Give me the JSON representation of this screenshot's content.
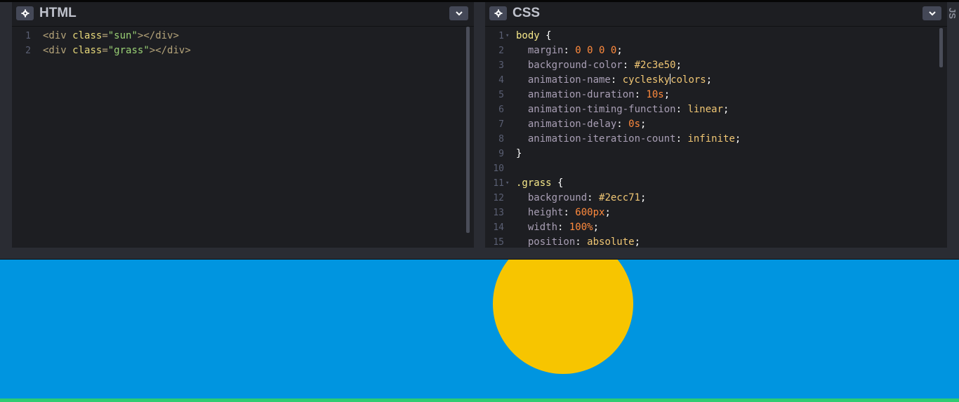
{
  "html_panel": {
    "title": "HTML",
    "lines": [
      {
        "n": "1",
        "parts": [
          [
            "tag",
            "<div "
          ],
          [
            "attr",
            "class"
          ],
          [
            "tag",
            "="
          ],
          [
            "str",
            "\"sun\""
          ],
          [
            "tag",
            "></div>"
          ]
        ]
      },
      {
        "n": "2",
        "parts": [
          [
            "tag",
            "<div "
          ],
          [
            "attr",
            "class"
          ],
          [
            "tag",
            "="
          ],
          [
            "str",
            "\"grass\""
          ],
          [
            "tag",
            "></div>"
          ]
        ]
      }
    ]
  },
  "css_panel": {
    "title": "CSS",
    "lines": [
      {
        "n": "1",
        "fold": true,
        "parts": [
          [
            "sel",
            "body "
          ],
          [
            "punc",
            "{"
          ]
        ]
      },
      {
        "n": "2",
        "parts": [
          [
            "prop",
            "  margin"
          ],
          [
            "punc",
            ": "
          ],
          [
            "num",
            "0 0 0 0"
          ],
          [
            "punc",
            ";"
          ]
        ]
      },
      {
        "n": "3",
        "parts": [
          [
            "prop",
            "  background-color"
          ],
          [
            "punc",
            ": "
          ],
          [
            "val",
            "#2c3e50"
          ],
          [
            "punc",
            ";"
          ]
        ]
      },
      {
        "n": "4",
        "parts": [
          [
            "prop",
            "  animation-name"
          ],
          [
            "punc",
            ": "
          ],
          [
            "val",
            "cyclesky"
          ],
          [
            "cursor",
            ""
          ],
          [
            "val",
            "colors"
          ],
          [
            "punc",
            ";"
          ]
        ]
      },
      {
        "n": "5",
        "parts": [
          [
            "prop",
            "  animation-duration"
          ],
          [
            "punc",
            ": "
          ],
          [
            "num",
            "10s"
          ],
          [
            "punc",
            ";"
          ]
        ]
      },
      {
        "n": "6",
        "parts": [
          [
            "prop",
            "  animation-timing-function"
          ],
          [
            "punc",
            ": "
          ],
          [
            "val",
            "linear"
          ],
          [
            "punc",
            ";"
          ]
        ]
      },
      {
        "n": "7",
        "parts": [
          [
            "prop",
            "  animation-delay"
          ],
          [
            "punc",
            ": "
          ],
          [
            "num",
            "0s"
          ],
          [
            "punc",
            ";"
          ]
        ]
      },
      {
        "n": "8",
        "parts": [
          [
            "prop",
            "  animation-iteration-count"
          ],
          [
            "punc",
            ": "
          ],
          [
            "val",
            "infinite"
          ],
          [
            "punc",
            ";"
          ]
        ]
      },
      {
        "n": "9",
        "parts": [
          [
            "punc",
            "}"
          ]
        ]
      },
      {
        "n": "10",
        "parts": []
      },
      {
        "n": "11",
        "fold": true,
        "parts": [
          [
            "sel",
            ".grass "
          ],
          [
            "punc",
            "{"
          ]
        ]
      },
      {
        "n": "12",
        "parts": [
          [
            "prop",
            "  background"
          ],
          [
            "punc",
            ": "
          ],
          [
            "val",
            "#2ecc71"
          ],
          [
            "punc",
            ";"
          ]
        ]
      },
      {
        "n": "13",
        "parts": [
          [
            "prop",
            "  height"
          ],
          [
            "punc",
            ": "
          ],
          [
            "num",
            "600px"
          ],
          [
            "punc",
            ";"
          ]
        ]
      },
      {
        "n": "14",
        "parts": [
          [
            "prop",
            "  width"
          ],
          [
            "punc",
            ": "
          ],
          [
            "num",
            "100%"
          ],
          [
            "punc",
            ";"
          ]
        ]
      },
      {
        "n": "15",
        "parts": [
          [
            "prop",
            "  position"
          ],
          [
            "punc",
            ": "
          ],
          [
            "val",
            "absolute"
          ],
          [
            "punc",
            ";"
          ]
        ]
      }
    ]
  },
  "js_panel": {
    "title": "JS"
  },
  "icons": {
    "settings": "gear-icon",
    "collapse": "chevron-down-icon"
  },
  "colors": {
    "preview_bg": "#0095e0",
    "sun": "#f7c500",
    "grass": "#2ecc71"
  }
}
